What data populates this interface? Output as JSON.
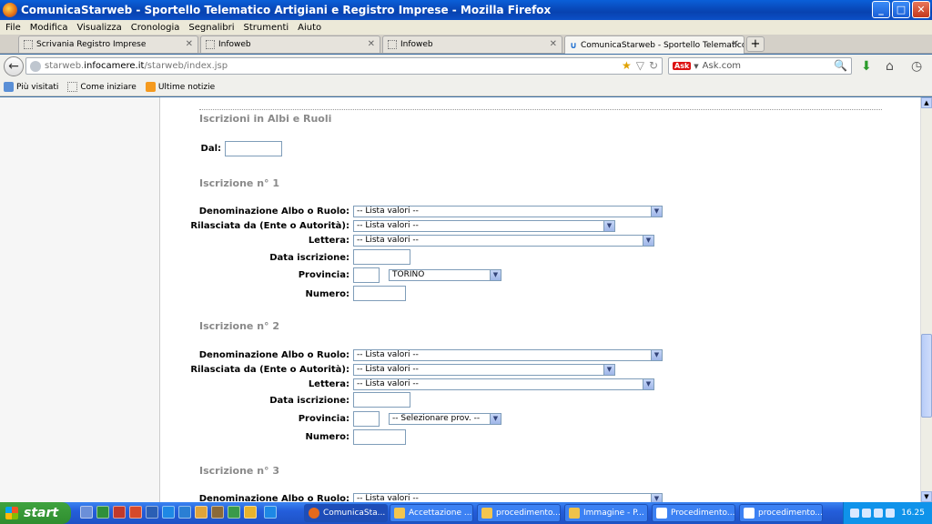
{
  "window": {
    "title": "ComunicaStarweb - Sportello Telematico Artigiani e Registro Imprese - Mozilla Firefox",
    "minimize": "_",
    "maximize": "□",
    "close": "✕"
  },
  "menu": [
    "File",
    "Modifica",
    "Visualizza",
    "Cronologia",
    "Segnalibri",
    "Strumenti",
    "Aiuto"
  ],
  "tabs": [
    {
      "label": "Scrivania Registro Imprese"
    },
    {
      "label": "Infoweb"
    },
    {
      "label": "Infoweb"
    },
    {
      "label": "ComunicaStarweb - Sportello Telematico ..."
    }
  ],
  "newtab_label": "+",
  "tab_close": "✕",
  "nav": {
    "url_prefix": "starweb.",
    "url_host": "infocamere.it",
    "url_path": "/starweb/index.jsp",
    "search_placeholder": "Ask.com",
    "search_logo": "Ask"
  },
  "bookmarks": [
    "Più visitati",
    "Come iniziare",
    "Ultime notizie"
  ],
  "form": {
    "section_title": "Iscrizioni in Albi e Ruoli",
    "dal_label": "Dal:",
    "labels": {
      "denominazione": "Denominazione Albo o Ruolo:",
      "rilasciata": "Rilasciata da (Ente o Autorità):",
      "lettera": "Lettera:",
      "data": "Data iscrizione:",
      "provincia": "Provincia:",
      "numero": "Numero:"
    },
    "iscrizioni": [
      {
        "title": "Iscrizione n° 1",
        "denominazione": "-- Lista valori --",
        "rilasciata": "-- Lista valori --",
        "lettera": "-- Lista valori --",
        "provincia": "TORINO"
      },
      {
        "title": "Iscrizione n° 2",
        "denominazione": "-- Lista valori --",
        "rilasciata": "-- Lista valori --",
        "lettera": "-- Lista valori --",
        "provincia": "-- Selezionare prov. --"
      },
      {
        "title": "Iscrizione n° 3",
        "denominazione": "-- Lista valori --"
      }
    ]
  },
  "taskbar": {
    "start": "start",
    "tasks": [
      "ComunicaSta...",
      "Accettazione ...",
      "procedimento...",
      "Immagine - P...",
      "Procedimento...",
      "procedimento..."
    ],
    "clock": "16.25"
  }
}
